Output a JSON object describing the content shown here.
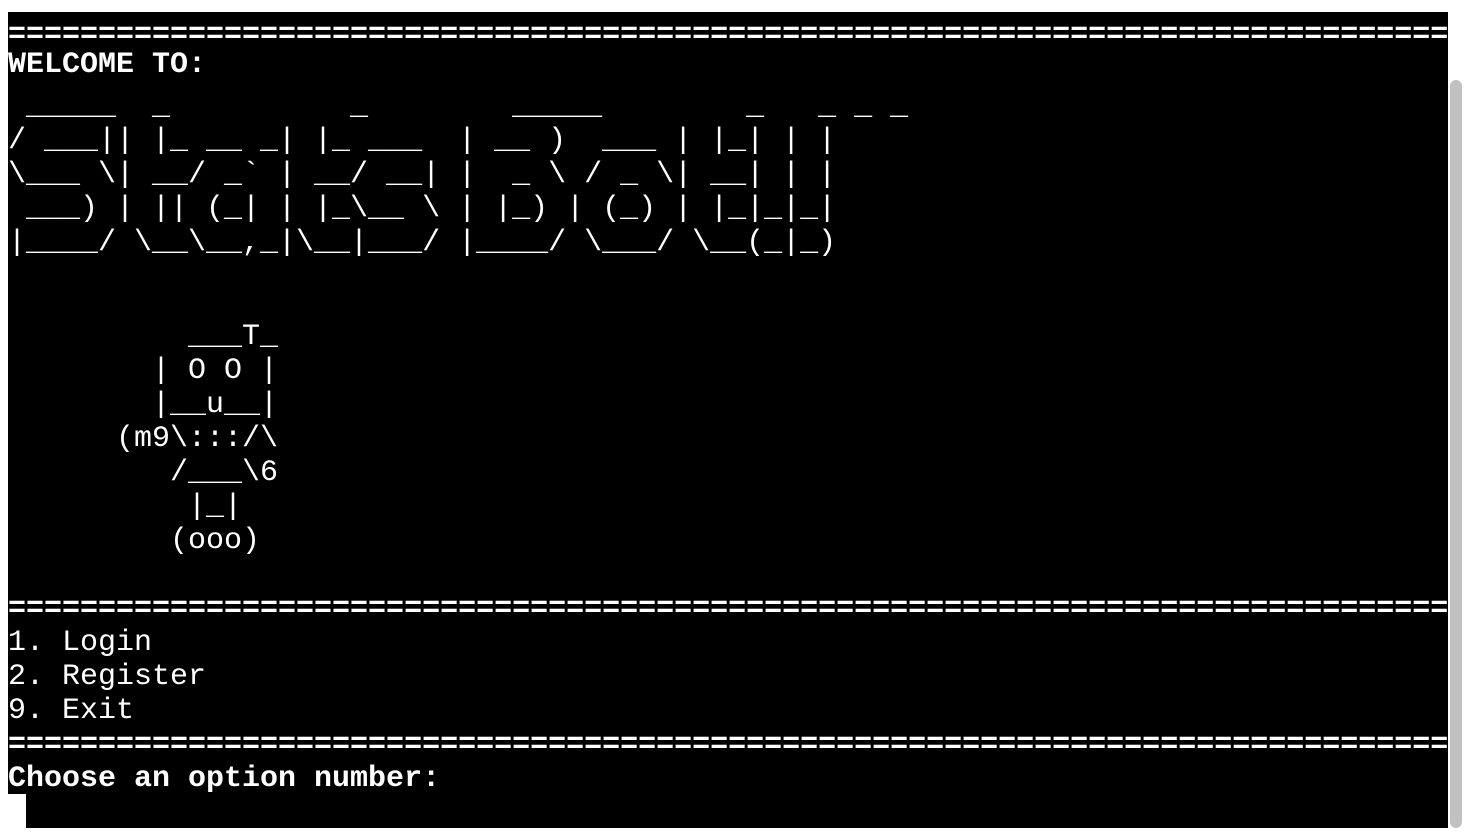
{
  "terminal": {
    "divider": "================================================================================",
    "welcome": "WELCOME TO:",
    "logo_lines": [
      " _____  _          _        _____        _   _ _ _ ",
      "/ ___|| |_ __ _| |_ ___  | __ )  ___ | |_| | |",
      "\\___ \\| __/ _` | __/ __| |  _ \\ / _ \\| __| | |",
      " ___) | || (_| | |_\\__ \\ | |_) | (_) | |_|_|_|",
      "|____/ \\__\\__,_|\\__|___/ |____/ \\___/ \\__(_|_)"
    ],
    "robot_lines": [
      "          ___T_",
      "        | O O |",
      "        |__u__|",
      "      (m9\\:::/\\",
      "         /___\\6",
      "          |_|",
      "         (ooo)"
    ],
    "menu": [
      "1. Login",
      "2. Register",
      "9. Exit"
    ],
    "prompt": "Choose an option number:"
  }
}
